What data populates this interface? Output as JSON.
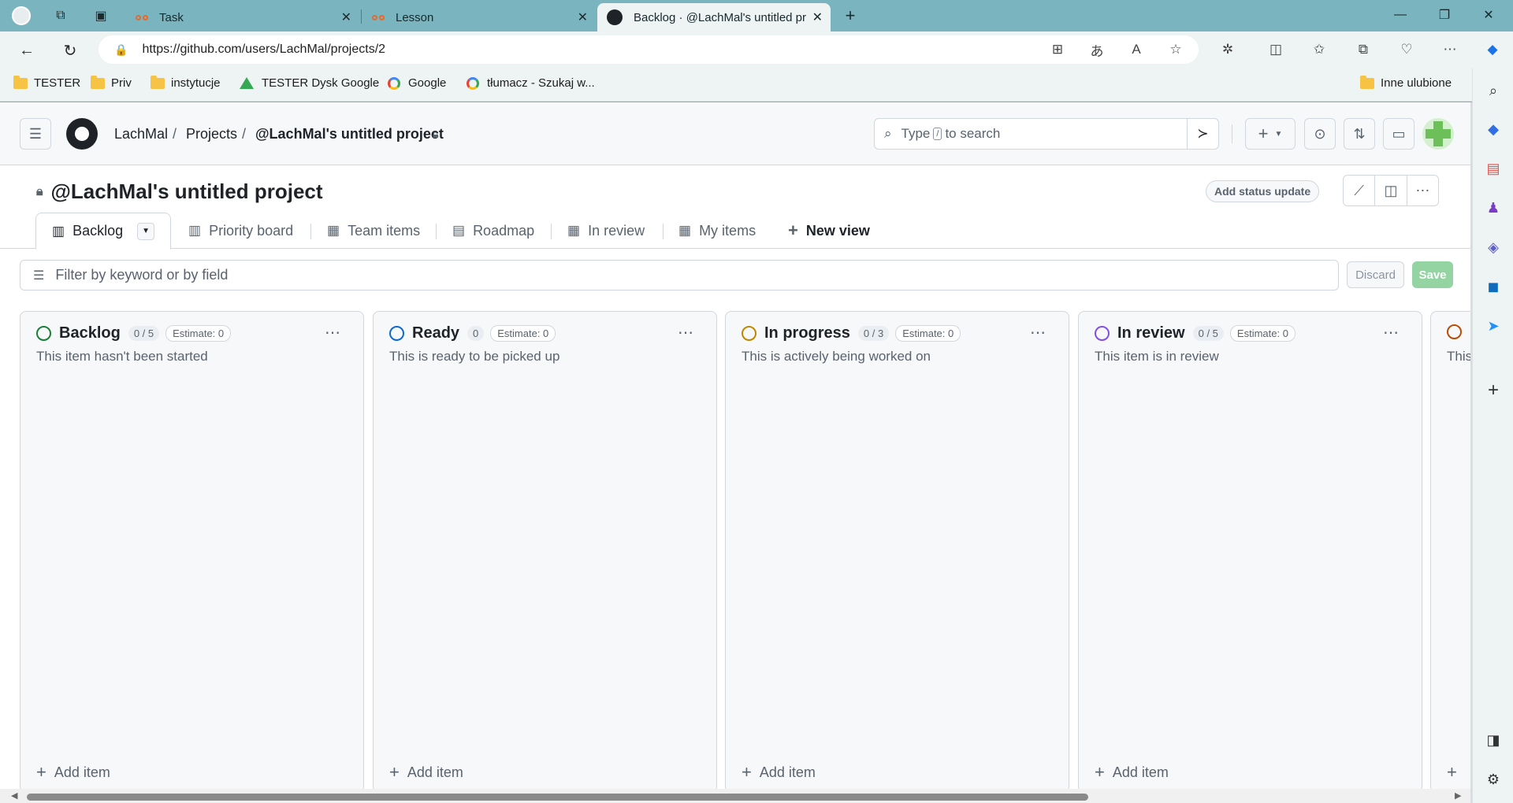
{
  "browser": {
    "tabs": [
      {
        "label": "Task"
      },
      {
        "label": "Lesson"
      },
      {
        "label": "Backlog · @LachMal's untitled pr"
      }
    ],
    "url": "https://github.com/users/LachMal/projects/2",
    "bookmarks": [
      {
        "label": "TESTER",
        "icon": "folder-icon"
      },
      {
        "label": "Priv",
        "icon": "folder-icon"
      },
      {
        "label": "instytucje",
        "icon": "folder-icon"
      },
      {
        "label": "TESTER Dysk Google",
        "icon": "google-drive-icon"
      },
      {
        "label": "Google",
        "icon": "google-icon"
      },
      {
        "label": "tłumacz - Szukaj w...",
        "icon": "google-icon"
      },
      {
        "label": "Inne ulubione",
        "icon": "folder-icon"
      }
    ]
  },
  "github": {
    "breadcrumb": [
      "LachMal",
      "Projects",
      "@LachMal's untitled project"
    ],
    "search_before": "Type",
    "search_key": "/",
    "search_after": "to search"
  },
  "project": {
    "title": "@LachMal's untitled project",
    "status_button": "Add status update",
    "views": [
      {
        "label": "Backlog",
        "icon": "board-icon"
      },
      {
        "label": "Priority board",
        "icon": "board-icon"
      },
      {
        "label": "Team items",
        "icon": "table-icon"
      },
      {
        "label": "Roadmap",
        "icon": "roadmap-icon"
      },
      {
        "label": "In review",
        "icon": "table-icon"
      },
      {
        "label": "My items",
        "icon": "table-icon"
      }
    ],
    "new_view": "New view",
    "filter_placeholder": "Filter by keyword or by field",
    "discard": "Discard",
    "save": "Save"
  },
  "board": {
    "columns": [
      {
        "name": "Backlog",
        "count": "0 / 5",
        "estimate": "Estimate: 0",
        "description": "This item hasn't been started",
        "color": "#1a7f37",
        "add": "Add item"
      },
      {
        "name": "Ready",
        "count": "0",
        "estimate": "Estimate: 0",
        "description": "This is ready to be picked up",
        "color": "#0969da",
        "add": "Add item"
      },
      {
        "name": "In progress",
        "count": "0 / 3",
        "estimate": "Estimate: 0",
        "description": "This is actively being worked on",
        "color": "#bf8700",
        "add": "Add item"
      },
      {
        "name": "In review",
        "count": "0 / 5",
        "estimate": "Estimate: 0",
        "description": "This item is in review",
        "color": "#8250df",
        "add": "Add item"
      },
      {
        "name": "",
        "count": "",
        "estimate": "",
        "description": "This",
        "color": "#bc4c00",
        "add": ""
      }
    ]
  }
}
